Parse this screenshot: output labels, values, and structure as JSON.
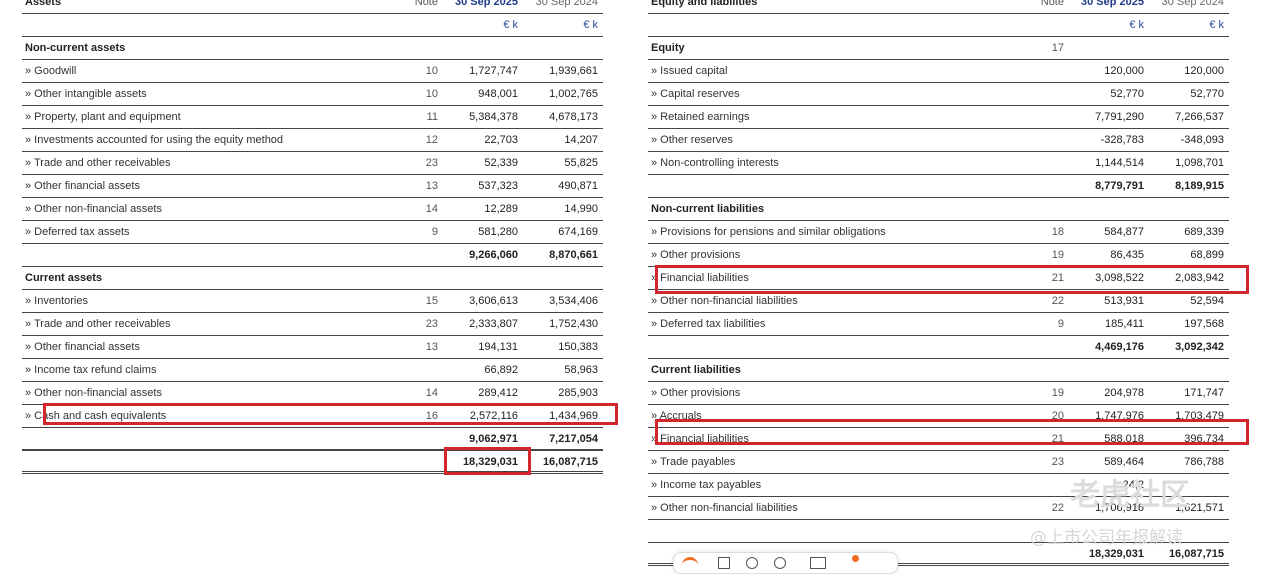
{
  "assets": {
    "header": {
      "title": "Assets",
      "note": "Note",
      "col1": "30 Sep 2025",
      "col2": "30 Sep 2024"
    },
    "unit": {
      "col1": "€ k",
      "col2": "€ k"
    },
    "rows": [
      {
        "label": "Non-current assets",
        "note": "",
        "v1": "",
        "v2": "",
        "type": "section"
      },
      {
        "label": "» Goodwill",
        "note": "10",
        "v1": "1,727,747",
        "v2": "1,939,661",
        "type": "item"
      },
      {
        "label": "» Other intangible assets",
        "note": "10",
        "v1": "948,001",
        "v2": "1,002,765",
        "type": "item"
      },
      {
        "label": "» Property, plant and equipment",
        "note": "11",
        "v1": "5,384,378",
        "v2": "4,678,173",
        "type": "item"
      },
      {
        "label": "» Investments accounted for using the equity method",
        "note": "12",
        "v1": "22,703",
        "v2": "14,207",
        "type": "item"
      },
      {
        "label": "» Trade and other receivables",
        "note": "23",
        "v1": "52,339",
        "v2": "55,825",
        "type": "item"
      },
      {
        "label": "» Other financial assets",
        "note": "13",
        "v1": "537,323",
        "v2": "490,871",
        "type": "item"
      },
      {
        "label": "» Other non-financial assets",
        "note": "14",
        "v1": "12,289",
        "v2": "14,990",
        "type": "item"
      },
      {
        "label": "» Deferred tax assets",
        "note": "9",
        "v1": "581,280",
        "v2": "674,169",
        "type": "item"
      },
      {
        "label": "",
        "note": "",
        "v1": "9,266,060",
        "v2": "8,870,661",
        "type": "total"
      },
      {
        "label": "Current assets",
        "note": "",
        "v1": "",
        "v2": "",
        "type": "section"
      },
      {
        "label": "» Inventories",
        "note": "15",
        "v1": "3,606,613",
        "v2": "3,534,406",
        "type": "item"
      },
      {
        "label": "» Trade and other receivables",
        "note": "23",
        "v1": "2,333,807",
        "v2": "1,752,430",
        "type": "item"
      },
      {
        "label": "» Other financial assets",
        "note": "13",
        "v1": "194,131",
        "v2": "150,383",
        "type": "item"
      },
      {
        "label": "» Income tax refund claims",
        "note": "",
        "v1": "66,892",
        "v2": "58,963",
        "type": "item"
      },
      {
        "label": "» Other non-financial assets",
        "note": "14",
        "v1": "289,412",
        "v2": "285,903",
        "type": "item"
      },
      {
        "label": "» Cash and cash equivalents",
        "note": "16",
        "v1": "2,572,116",
        "v2": "1,434,969",
        "type": "item"
      },
      {
        "label": "",
        "note": "",
        "v1": "9,062,971",
        "v2": "7,217,054",
        "type": "total-thick"
      },
      {
        "label": "",
        "note": "",
        "v1": "18,329,031",
        "v2": "16,087,715",
        "type": "grand"
      }
    ]
  },
  "equity_liabilities": {
    "header": {
      "title": "Equity and liabilities",
      "note": "Note",
      "col1": "30 Sep 2025",
      "col2": "30 Sep 2024"
    },
    "unit": {
      "col1": "€ k",
      "col2": "€ k"
    },
    "rows": [
      {
        "label": "Equity",
        "note": "17",
        "v1": "",
        "v2": "",
        "type": "section"
      },
      {
        "label": "» Issued capital",
        "note": "",
        "v1": "120,000",
        "v2": "120,000",
        "type": "item"
      },
      {
        "label": "» Capital reserves",
        "note": "",
        "v1": "52,770",
        "v2": "52,770",
        "type": "item"
      },
      {
        "label": "» Retained earnings",
        "note": "",
        "v1": "7,791,290",
        "v2": "7,266,537",
        "type": "item"
      },
      {
        "label": "» Other reserves",
        "note": "",
        "v1": "-328,783",
        "v2": "-348,093",
        "type": "item"
      },
      {
        "label": "» Non-controlling interests",
        "note": "",
        "v1": "1,144,514",
        "v2": "1,098,701",
        "type": "item"
      },
      {
        "label": "",
        "note": "",
        "v1": "8,779,791",
        "v2": "8,189,915",
        "type": "total"
      },
      {
        "label": "Non-current liabilities",
        "note": "",
        "v1": "",
        "v2": "",
        "type": "section"
      },
      {
        "label": "» Provisions for pensions and similar obligations",
        "note": "18",
        "v1": "584,877",
        "v2": "689,339",
        "type": "item"
      },
      {
        "label": "» Other provisions",
        "note": "19",
        "v1": "86,435",
        "v2": "68,899",
        "type": "item"
      },
      {
        "label": "» Financial liabilities",
        "note": "21",
        "v1": "3,098,522",
        "v2": "2,083,942",
        "type": "item"
      },
      {
        "label": "» Other non-financial liabilities",
        "note": "22",
        "v1": "513,931",
        "v2": "52,594",
        "type": "item"
      },
      {
        "label": "» Deferred tax liabilities",
        "note": "9",
        "v1": "185,411",
        "v2": "197,568",
        "type": "item"
      },
      {
        "label": "",
        "note": "",
        "v1": "4,469,176",
        "v2": "3,092,342",
        "type": "total"
      },
      {
        "label": "Current liabilities",
        "note": "",
        "v1": "",
        "v2": "",
        "type": "section"
      },
      {
        "label": "» Other provisions",
        "note": "19",
        "v1": "204,978",
        "v2": "171,747",
        "type": "item"
      },
      {
        "label": "» Accruals",
        "note": "20",
        "v1": "1,747,976",
        "v2": "1,703,479",
        "type": "item"
      },
      {
        "label": "» Financial liabilities",
        "note": "21",
        "v1": "588,018",
        "v2": "396,734",
        "type": "item"
      },
      {
        "label": "» Trade payables",
        "note": "23",
        "v1": "589,464",
        "v2": "786,788",
        "type": "item"
      },
      {
        "label": "» Income tax payables",
        "note": "",
        "v1": "24,2",
        "v2": "",
        "type": "item"
      },
      {
        "label": "» Other non-financial liabilities",
        "note": "22",
        "v1": "1,706,916",
        "v2": "1,621,571",
        "type": "item"
      },
      {
        "label": "",
        "note": "",
        "v1": "",
        "v2": "",
        "type": "total"
      },
      {
        "label": "",
        "note": "",
        "v1": "18,329,031",
        "v2": "16,087,715",
        "type": "grand"
      }
    ]
  },
  "watermark": {
    "text1": "老虎社区",
    "text2": "@上市公司年报解读"
  }
}
